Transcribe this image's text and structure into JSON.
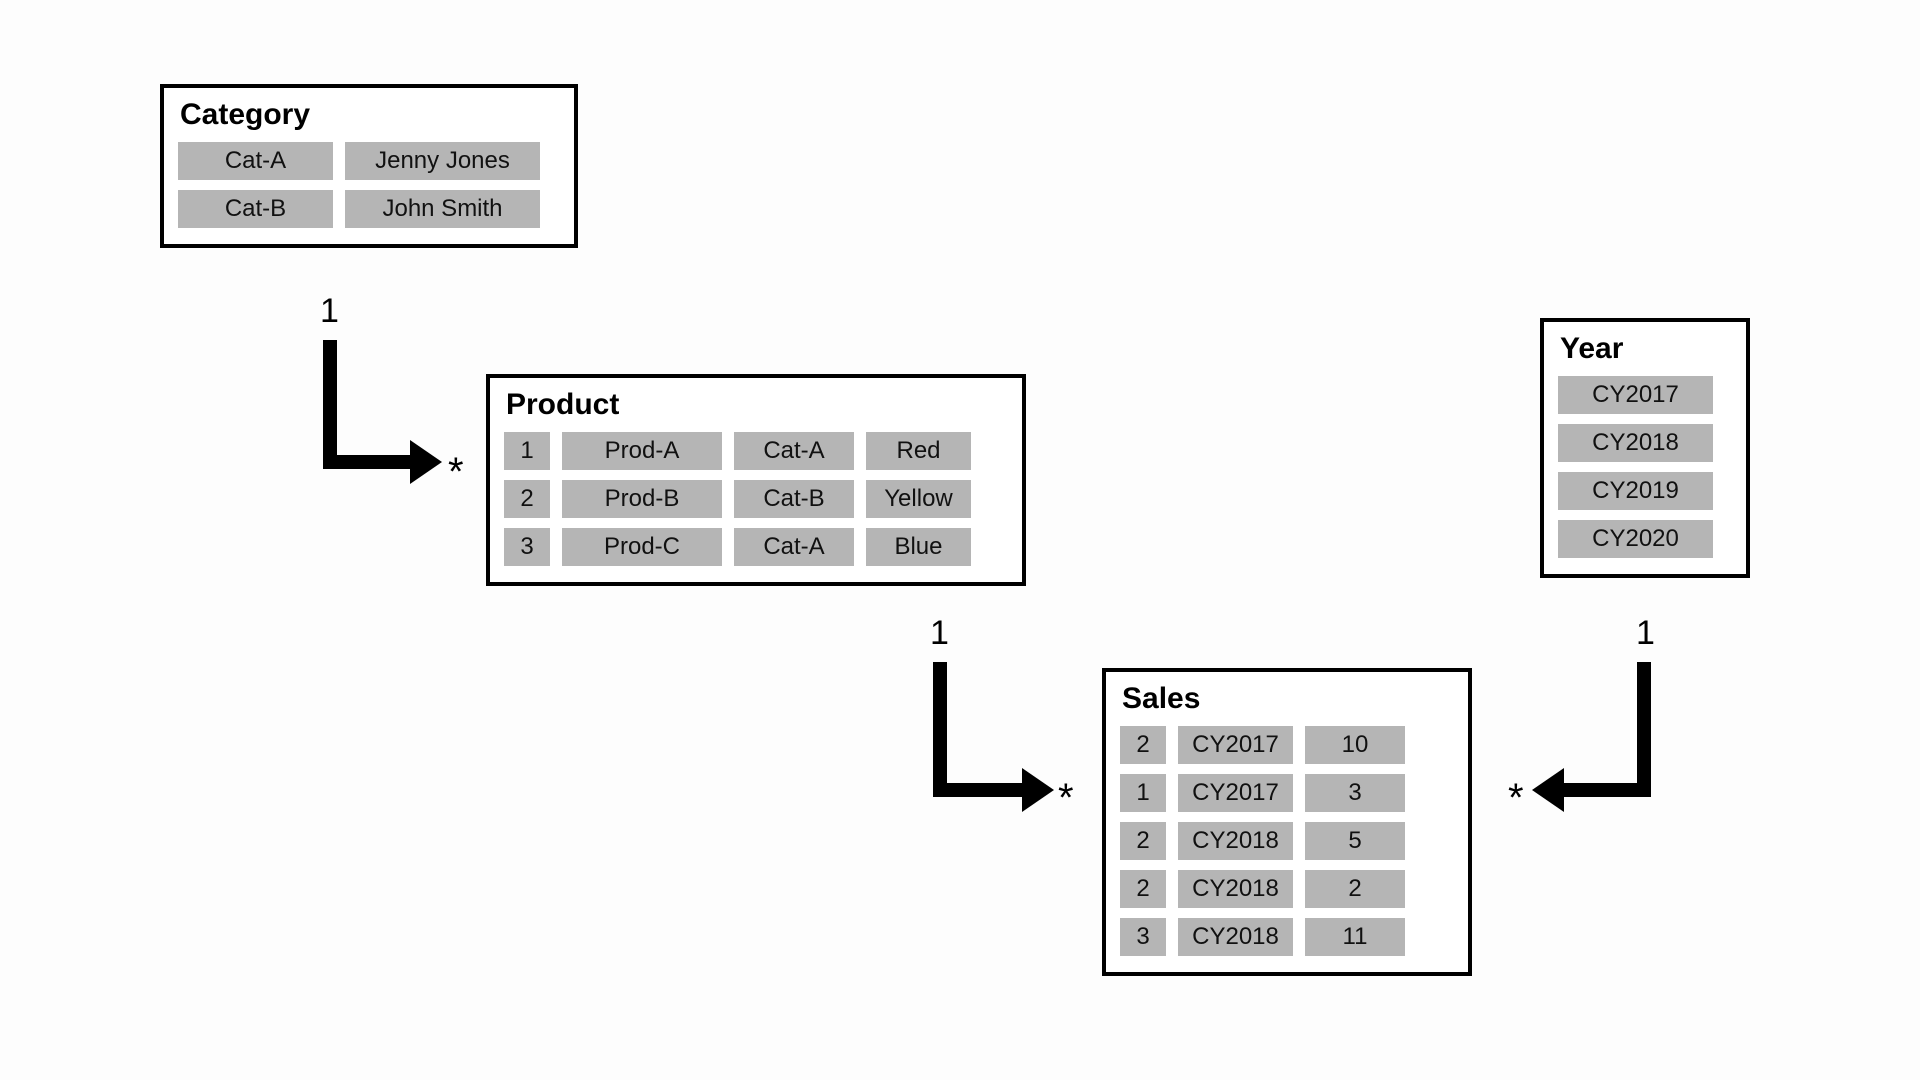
{
  "entities": {
    "category": {
      "title": "Category",
      "rows": [
        [
          "Cat-A",
          "Jenny Jones"
        ],
        [
          "Cat-B",
          "John Smith"
        ]
      ]
    },
    "product": {
      "title": "Product",
      "rows": [
        [
          "1",
          "Prod-A",
          "Cat-A",
          "Red"
        ],
        [
          "2",
          "Prod-B",
          "Cat-B",
          "Yellow"
        ],
        [
          "3",
          "Prod-C",
          "Cat-A",
          "Blue"
        ]
      ]
    },
    "sales": {
      "title": "Sales",
      "rows": [
        [
          "2",
          "CY2017",
          "10"
        ],
        [
          "1",
          "CY2017",
          "3"
        ],
        [
          "2",
          "CY2018",
          "5"
        ],
        [
          "2",
          "CY2018",
          "2"
        ],
        [
          "3",
          "CY2018",
          "11"
        ]
      ]
    },
    "year": {
      "title": "Year",
      "rows": [
        [
          "CY2017"
        ],
        [
          "CY2018"
        ],
        [
          "CY2019"
        ],
        [
          "CY2020"
        ]
      ]
    }
  },
  "cardinality": {
    "one": "1",
    "many": "*"
  }
}
